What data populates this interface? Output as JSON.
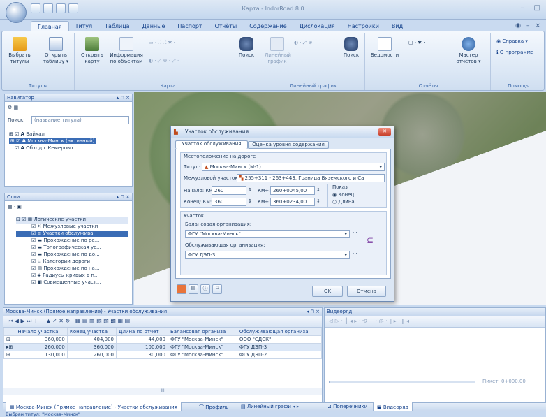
{
  "app": {
    "title": "Карта - IndorRoad 8.0"
  },
  "tabs": [
    "Главная",
    "Титул",
    "Таблица",
    "Данные",
    "Паспорт",
    "Отчёты",
    "Содержание",
    "Дислокация",
    "Настройки",
    "Вид"
  ],
  "ribbon": {
    "buttons": {
      "select_titles": "Выбрать\nтитулы",
      "open_table": "Открыть\nтаблицу ▾",
      "open_map": "Открыть\nкарту",
      "object_info": "Информация\nпо объектам",
      "search1": "Поиск",
      "line_graph": "Линейный\nграфик",
      "search2": "Поиск",
      "statements": "Ведомости",
      "report_master": "Мастер\nотчётов ▾",
      "help_ref": "Справка ▾",
      "about": "О программе"
    },
    "groups": {
      "titles": "Титулы",
      "map": "Карта",
      "linear": "Линейный график",
      "reports": "Отчёты",
      "help": "Помощь"
    }
  },
  "navigator": {
    "title": "Навигатор",
    "search_label": "Поиск:",
    "search_placeholder": "(название титула)",
    "items": [
      "Байкал",
      "Москва-Минск (активный)",
      "Обход г.Кемерово"
    ]
  },
  "layers": {
    "title": "Слои",
    "items": [
      "Логические участки",
      "Межузловые участки",
      "Участки обслужива",
      "Прохождение по ре...",
      "Топографическая ус...",
      "Прохождение по до...",
      "Категории дороги",
      "Прохождение по на...",
      "Радиусы кривых в п...",
      "Совмещенные участ..."
    ]
  },
  "dialog": {
    "title": "Участок обслуживания",
    "tab1": "Участок обслуживания",
    "tab2": "Оценка уровня содержания",
    "sec_location": "Местоположение на дороге",
    "titul_label": "Титул:",
    "titul_value": "Москва-Минск (М-1)",
    "interval_label": "Межузловой участок:",
    "interval_value": "255+311 - 263+443, Граница Вяземского и Са",
    "start_km_label": "Начало: Км:",
    "start_km": "260",
    "km_plus1_label": "Км+:",
    "km_plus1": "260+0045,00",
    "end_km_label": "Конец: Км:",
    "end_km": "360",
    "km_plus2_label": "Км+:",
    "km_plus2": "360+0234,00",
    "show_label": "Показ",
    "opt_end": "Конец",
    "opt_length": "Длина",
    "sec_plot": "Участок",
    "balance_label": "Балансовая организация:",
    "balance_value": "ФГУ \"Москва-Минск\"",
    "service_label": "Обслуживающая организация:",
    "service_value": "ФГУ ДЭП-3",
    "ok": "OK",
    "cancel": "Отмена"
  },
  "grid": {
    "title": "Москва-Минск (Прямое направление) - Участки обслуживания",
    "columns": [
      "Начало участка",
      "Конец участка",
      "Длина по отчет",
      "Балансовая организа",
      "Обслуживающая организа"
    ],
    "rows": [
      [
        "360,000",
        "404,000",
        "44,000",
        "ФГУ \"Москва-Минск\"",
        "ООО \"СДСК\""
      ],
      [
        "260,000",
        "360,000",
        "100,000",
        "ФГУ \"Москва-Минск\"",
        "ФГУ ДЭП-3"
      ],
      [
        "130,000",
        "260,000",
        "130,000",
        "ФГУ \"Москва-Минск\"",
        "ФГУ ДЭП-2"
      ]
    ],
    "hscroll": "III"
  },
  "video": {
    "title": "Видеоряд",
    "picket": "Пикет: 0+000,00"
  },
  "bottom_tabs": [
    "Москва-Минск (Прямое направление) - Участки обслуживания",
    "Профиль",
    "Линейный графи",
    "Поперечники",
    "Видеоряд"
  ],
  "status": "Выбран титул: \"Москва-Минск\""
}
